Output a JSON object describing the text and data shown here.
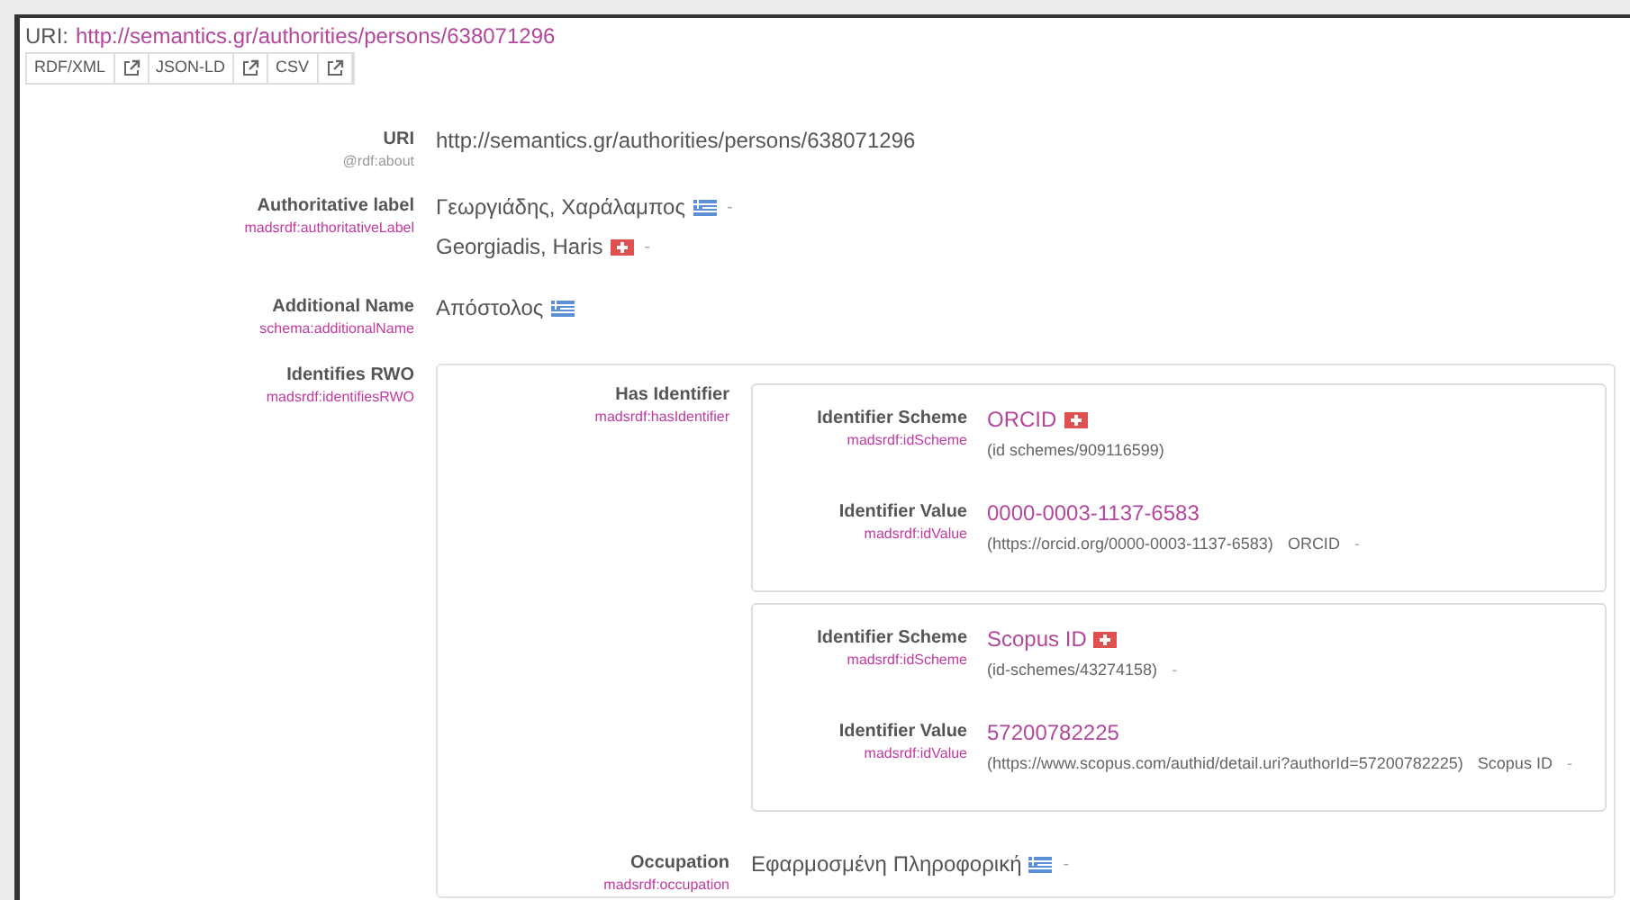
{
  "header": {
    "prefix": "URI:",
    "link": "http://semantics.gr/authorities/persons/638071296"
  },
  "formats": [
    {
      "label": "RDF/XML"
    },
    {
      "label": "JSON-LD"
    },
    {
      "label": "CSV"
    }
  ],
  "properties": [
    {
      "label": "URI",
      "prop": "@rdf:about",
      "muted": true,
      "values": [
        {
          "text": "http://semantics.gr/authorities/persons/638071296"
        }
      ]
    },
    {
      "label": "Authoritative label",
      "prop": "madsrdf:authoritativeLabel",
      "muted": false,
      "values": [
        {
          "text": "Γεωργιάδης, Χαράλαμπος",
          "flag": {
            "kind": "gr"
          },
          "suffix": "-"
        },
        {
          "text": "Georgiadis, Haris",
          "flag": {
            "kind": "en"
          },
          "suffix": "-"
        }
      ]
    },
    {
      "label": "Additional Name",
      "prop": "schema:additionalName",
      "muted": false,
      "values": [
        {
          "text": "Απόστολος",
          "flag": {
            "kind": "gr"
          }
        }
      ]
    },
    {
      "label": "Identifies RWO",
      "prop": "madsrdf:identifiesRWO",
      "muted": false,
      "nested": [
        {
          "label": "Has Identifier",
          "prop": "madsrdf:hasIdentifier",
          "muted": false,
          "cards": [
            {
              "fields": [
                {
                  "label": "Identifier Scheme",
                  "prop": "madsrdf:idScheme",
                  "value": "ORCID",
                  "flag": {
                    "kind": "en"
                  },
                  "detail": "(id schemes/909116599)"
                },
                {
                  "label": "Identifier Value",
                  "prop": "madsrdf:idValue",
                  "value": "0000-0003-1137-6583",
                  "detail": "(https://orcid.org/0000-0003-1137-6583)",
                  "detail_label": "ORCID",
                  "suffix": "-"
                }
              ]
            },
            {
              "fields": [
                {
                  "label": "Identifier Scheme",
                  "prop": "madsrdf:idScheme",
                  "value": "Scopus ID",
                  "flag": {
                    "kind": "en"
                  },
                  "detail": "(id-schemes/43274158)",
                  "suffix": "-"
                },
                {
                  "label": "Identifier Value",
                  "prop": "madsrdf:idValue",
                  "value": "57200782225",
                  "detail": "(https://www.scopus.com/authid/detail.uri?authorId=57200782225)",
                  "detail_label": "Scopus ID",
                  "suffix": "-"
                }
              ]
            }
          ]
        },
        {
          "label": "Occupation",
          "prop": "madsrdf:occupation",
          "muted": false,
          "values": [
            {
              "text": "Εφαρμοσμένη Πληροφορική",
              "flag": {
                "kind": "gr"
              },
              "suffix": "-"
            }
          ]
        }
      ]
    }
  ]
}
